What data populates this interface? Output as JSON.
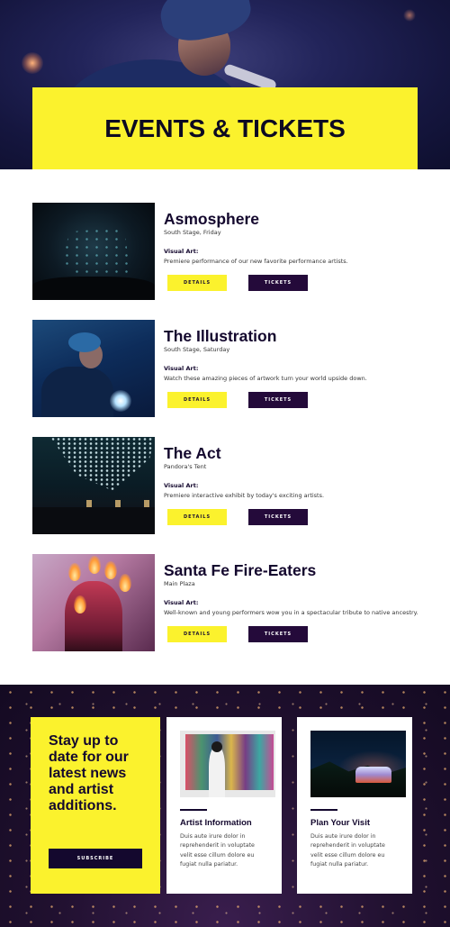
{
  "hero": {
    "title": "EVENTS & TICKETS"
  },
  "events": [
    {
      "name": "Asmosphere",
      "venue": "South Stage, Friday",
      "category": "Visual Art:",
      "description": "Premiere performance of our new favorite performance artists.",
      "details_label": "DETAILS",
      "tickets_label": "TICKETS"
    },
    {
      "name": "The Illustration",
      "venue": "South Stage, Saturday",
      "category": "Visual Art:",
      "description": "Watch these amazing pieces of artwork turn your world upside down.",
      "details_label": "DETAILS",
      "tickets_label": "TICKETS"
    },
    {
      "name": "The Act",
      "venue": "Pandora's Tent",
      "category": "Visual Art:",
      "description": "Premiere interactive exhibit by today's exciting artists.",
      "details_label": "DETAILS",
      "tickets_label": "TICKETS"
    },
    {
      "name": "Santa Fe Fire-Eaters",
      "venue": "Main Plaza",
      "category": "Visual Art:",
      "description": "Well-known and young performers wow you in a spectacular tribute to native ancestry.",
      "details_label": "DETAILS",
      "tickets_label": "TICKETS"
    }
  ],
  "newsletter": {
    "heading": "Stay up to date for our latest news and artist additions.",
    "button_label": "SUBSCRIBE"
  },
  "cards": [
    {
      "title": "Artist Information",
      "text": "Duis aute irure dolor in reprehenderit in voluptate velit esse cillum dolore eu fugiat nulla pariatur."
    },
    {
      "title": "Plan Your Visit",
      "text": "Duis aute irure dolor in reprehenderit in voluptate velit esse cillum dolore eu fugiat nulla pariatur."
    }
  ],
  "colors": {
    "accent_yellow": "#fbf22d",
    "dark_purple": "#240a3a",
    "navy_text": "#14082e"
  }
}
